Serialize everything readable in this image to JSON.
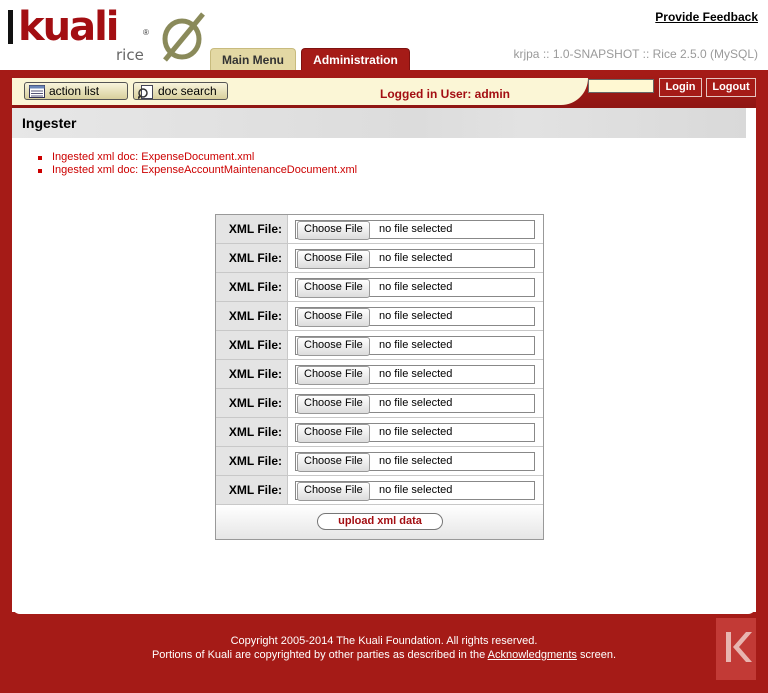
{
  "header": {
    "logo_text": "kuali",
    "logo_sub": "rice",
    "provide_feedback": "Provide Feedback",
    "tabs": [
      {
        "label": "Main Menu",
        "active": false
      },
      {
        "label": "Administration",
        "active": true
      }
    ],
    "version": "krjpa :: 1.0-SNAPSHOT :: Rice 2.5.0 (MySQL)"
  },
  "toolbar": {
    "action_list": "action list",
    "doc_search": "doc search",
    "logged_in": "Logged in User: admin",
    "login_input_value": "",
    "login": "Login",
    "logout": "Logout"
  },
  "page": {
    "title": "Ingester",
    "messages": [
      "Ingested xml doc: ExpenseDocument.xml",
      "Ingested xml doc: ExpenseAccountMaintenanceDocument.xml"
    ]
  },
  "form": {
    "rows": [
      {
        "label": "XML File:",
        "button": "Choose File",
        "status": "no file selected"
      },
      {
        "label": "XML File:",
        "button": "Choose File",
        "status": "no file selected"
      },
      {
        "label": "XML File:",
        "button": "Choose File",
        "status": "no file selected"
      },
      {
        "label": "XML File:",
        "button": "Choose File",
        "status": "no file selected"
      },
      {
        "label": "XML File:",
        "button": "Choose File",
        "status": "no file selected"
      },
      {
        "label": "XML File:",
        "button": "Choose File",
        "status": "no file selected"
      },
      {
        "label": "XML File:",
        "button": "Choose File",
        "status": "no file selected"
      },
      {
        "label": "XML File:",
        "button": "Choose File",
        "status": "no file selected"
      },
      {
        "label": "XML File:",
        "button": "Choose File",
        "status": "no file selected"
      },
      {
        "label": "XML File:",
        "button": "Choose File",
        "status": "no file selected"
      }
    ],
    "upload": "upload xml data"
  },
  "footer": {
    "copyright": "Copyright 2005-2014 The Kuali Foundation. All rights reserved.",
    "portions_pre": "Portions of Kuali are copyrighted by other parties as described in the ",
    "acknowledgments": "Acknowledgments",
    "portions_post": " screen."
  },
  "colors": {
    "brand_red": "#a51b17",
    "message_red": "#cc0000",
    "tab_main": "#e3d8a4",
    "toolbar_bg": "#fbf6d6"
  }
}
